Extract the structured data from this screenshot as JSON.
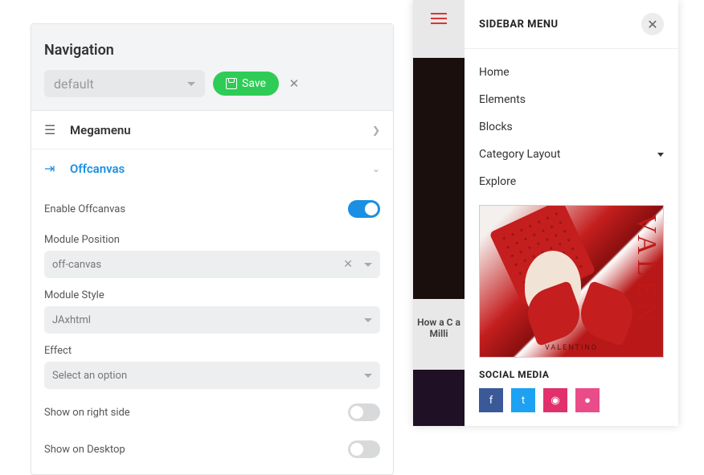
{
  "panel": {
    "title": "Navigation",
    "preset": "default",
    "save": "Save",
    "sections": {
      "mega": "Megamenu",
      "off": "Offcanvas"
    },
    "fields": {
      "enable": "Enable Offcanvas",
      "modpos_label": "Module Position",
      "modpos_value": "off-canvas",
      "modstyle_label": "Module Style",
      "modstyle_value": "JAxhtml",
      "effect_label": "Effect",
      "effect_value": "Select an option",
      "right": "Show on right side",
      "desktop": "Show on Desktop"
    }
  },
  "sidebar": {
    "title": "SIDEBAR MENU",
    "items": [
      "Home",
      "Elements",
      "Blocks",
      "Category Layout",
      "Explore"
    ],
    "promo_text": "VALEN",
    "promo_brand": "VALENTINO",
    "bg_caption": "How a C a Milli",
    "social_title": "SOCIAL MEDIA",
    "social": {
      "fb": "f",
      "tw": "t",
      "ig": "◉",
      "db": "●"
    }
  }
}
